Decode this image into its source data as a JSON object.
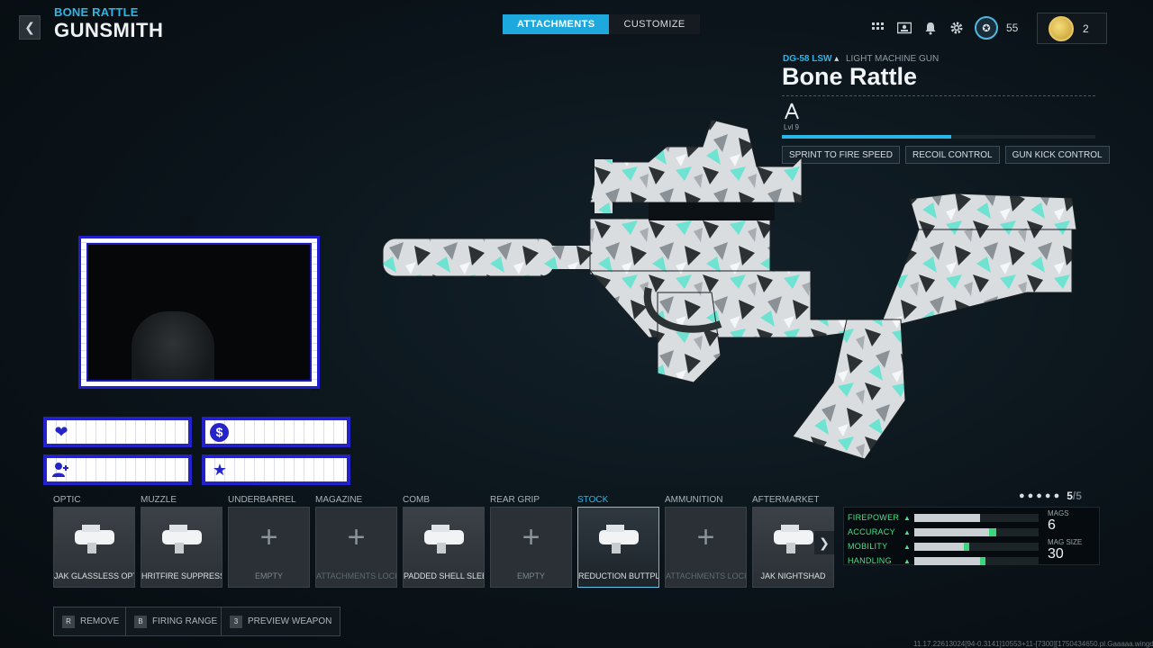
{
  "header": {
    "subtitle": "BONE RATTLE",
    "title": "GUNSMITH",
    "back_icon": "chevron-left-icon"
  },
  "tabs": [
    {
      "label": "ATTACHMENTS",
      "active": true
    },
    {
      "label": "CUSTOMIZE",
      "active": false
    }
  ],
  "top_bar": {
    "icons": [
      "grid-icon",
      "profile-card-icon",
      "bell-icon",
      "gear-icon"
    ],
    "rank_level": "55",
    "currency_count": "2"
  },
  "weapon": {
    "code": "DG-58 LSW",
    "class": "LIGHT MACHINE GUN",
    "name": "Bone Rattle",
    "level_text": "Lvl 9",
    "xp_progress": 0.54,
    "perks": [
      "SPRINT TO FIRE SPEED",
      "RECOIL CONTROL",
      "GUN KICK CONTROL"
    ]
  },
  "attachments": [
    {
      "category": "OPTIC",
      "name": "JAK GLASSLESS OPTIC",
      "state": "filled"
    },
    {
      "category": "MUZZLE",
      "name": "HRITFIRE SUPPRESSOR",
      "state": "filled"
    },
    {
      "category": "UNDERBARREL",
      "name": "EMPTY",
      "state": "empty"
    },
    {
      "category": "MAGAZINE",
      "name": "ATTACHMENTS LOCKE",
      "state": "locked"
    },
    {
      "category": "COMB",
      "name": "PADDED SHELL SLEEVE",
      "state": "filled"
    },
    {
      "category": "REAR GRIP",
      "name": "EMPTY",
      "state": "empty"
    },
    {
      "category": "STOCK",
      "name": "REDUCTION BUTTPLATE",
      "state": "selected"
    },
    {
      "category": "AMMUNITION",
      "name": "ATTACHMENTS LOCKE",
      "state": "locked"
    },
    {
      "category": "AFTERMARKET",
      "name": "JAK NIGHTSHAD",
      "state": "filled"
    }
  ],
  "stats": {
    "page_current": "5",
    "page_total": "/5",
    "rows": [
      {
        "label": "FIREPOWER",
        "value": 0.53,
        "bonus": 0.0
      },
      {
        "label": "ACCURACY",
        "value": 0.6,
        "bonus": 0.06
      },
      {
        "label": "MOBILITY",
        "value": 0.4,
        "bonus": 0.04
      },
      {
        "label": "HANDLING",
        "value": 0.53,
        "bonus": 0.04
      }
    ],
    "mags_label": "MAGS",
    "mags_value": "6",
    "mag_size_label": "MAG SIZE",
    "mag_size_value": "30"
  },
  "footer": {
    "buttons": [
      {
        "key": "R",
        "label": "REMOVE"
      },
      {
        "key": "B",
        "label": "FIRING RANGE"
      },
      {
        "key": "3",
        "label": "PREVIEW WEAPON"
      }
    ],
    "build_string": "11.17.22613024[94-0.3141]10553+11-[7300][1750434650.pl.Gaaaaa.wingdc"
  },
  "colors": {
    "accent": "#29b6e8",
    "stat_green": "#4de08b",
    "frame_blue": "#2222c8"
  }
}
